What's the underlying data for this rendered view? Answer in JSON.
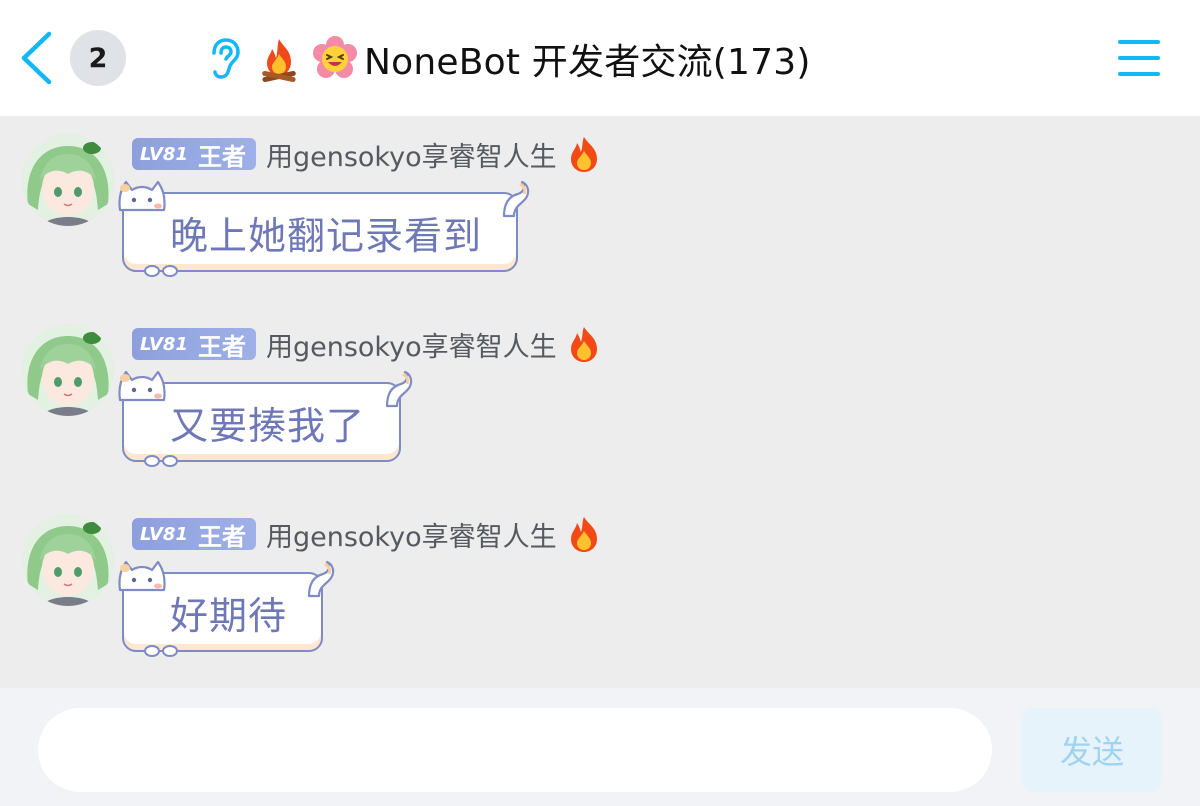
{
  "header": {
    "unread_count": "2",
    "title": "NoneBot 开发者交流(173)",
    "icons": [
      "back-arrow-icon",
      "ear-icon",
      "fire-icon",
      "laughing-flower-icon",
      "menu-icon"
    ]
  },
  "messages": [
    {
      "level": "LV81",
      "level_title": "王者",
      "nickname": "用gensokyo享睿智人生",
      "text": "晚上她翻记录看到"
    },
    {
      "level": "LV81",
      "level_title": "王者",
      "nickname": "用gensokyo享睿智人生",
      "text": "又要揍我了"
    },
    {
      "level": "LV81",
      "level_title": "王者",
      "nickname": "用gensokyo享睿智人生",
      "text": "好期待"
    }
  ],
  "composer": {
    "value": "",
    "send_label": "发送"
  },
  "colors": {
    "accent": "#12b7f5",
    "bubble_border": "#7f8cc4",
    "bubble_text": "#6f78b6",
    "level_tag": "#9aaae4",
    "background": "#ededed"
  }
}
